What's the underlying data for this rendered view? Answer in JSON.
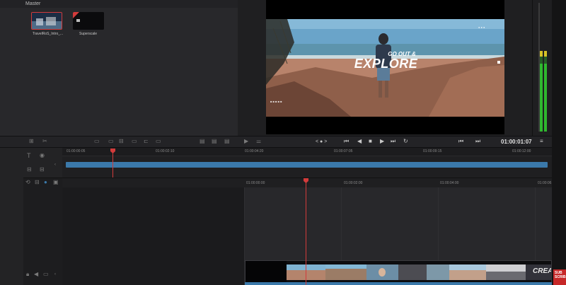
{
  "media_pool": {
    "header": "Master",
    "clips": [
      {
        "label": "TravelRoS_Intro_..."
      },
      {
        "label": "Superscale"
      }
    ]
  },
  "viewer": {
    "title_line1": "GO OUT &",
    "title_line2": "EXPLORE",
    "zoom": "< ● >",
    "timecode": "01:00:01:07"
  },
  "upper_ruler": {
    "labels": [
      "01:00:00:05",
      "01:00:02:10",
      "01:00:04:20",
      "01:00:07:05",
      "01:00:09:15",
      "01:00:12:00"
    ]
  },
  "lower_ruler": {
    "labels": [
      "01:00:00:00",
      "01:00:02:00",
      "01:00:04:00",
      "01:00:06"
    ]
  },
  "clip_overlay_text": "CREA",
  "subscribe_badge": "SUB SCRIB",
  "colors": {
    "accent_blue": "#3b79aa",
    "playhead_red": "#d23b3b",
    "meter_green": "#2fb82f",
    "meter_yellow": "#d7c227"
  }
}
